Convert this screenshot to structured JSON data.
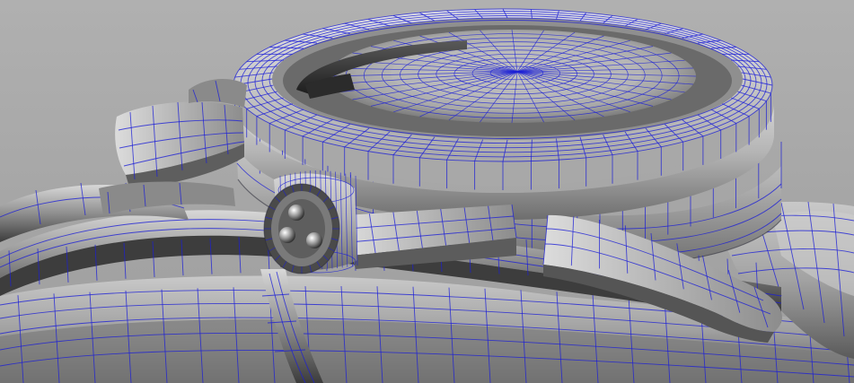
{
  "viewport": {
    "mode": "wireframe-on-shaded",
    "background_color": "#a7a7a7",
    "wire_color": "#1c1fd6",
    "surface_colors": {
      "light": "#d4d4d4",
      "mid": "#9c9c9c",
      "dark": "#3e3e3e",
      "shadow": "#1e1e1e"
    }
  },
  "model": {
    "parts": [
      {
        "id": "bezel",
        "name": "watch-bezel"
      },
      {
        "id": "crystal",
        "name": "watch-crystal-dome"
      },
      {
        "id": "case",
        "name": "watch-case-body"
      },
      {
        "id": "crown",
        "name": "watch-crown"
      },
      {
        "id": "crown-guard-top",
        "name": "crown-guard-upper"
      },
      {
        "id": "crown-guard-bottom",
        "name": "crown-guard-lower"
      },
      {
        "id": "lug-left",
        "name": "lug-left"
      },
      {
        "id": "lug-right",
        "name": "lug-right"
      },
      {
        "id": "strap-loop",
        "name": "strap-loop"
      },
      {
        "id": "strap-base",
        "name": "strap-base"
      },
      {
        "id": "side-buttons",
        "name": "side-pusher-ridges"
      }
    ]
  }
}
